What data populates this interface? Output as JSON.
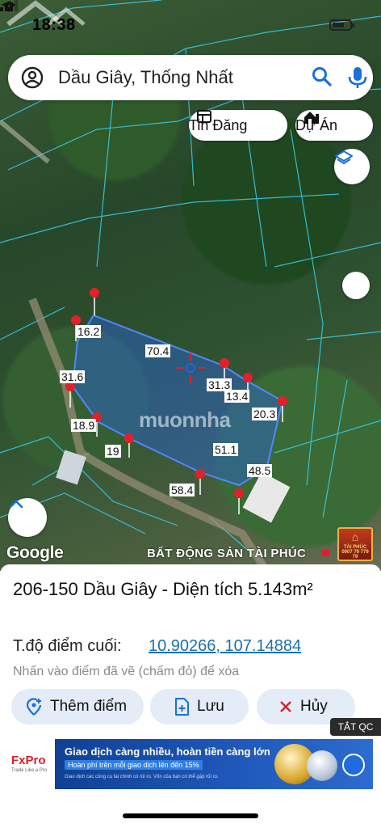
{
  "status_bar": {
    "time": "18:38"
  },
  "search": {
    "value": "Dầu Giây, Thống Nhất"
  },
  "chips": {
    "tin_dang": "Tin Đăng",
    "du_an": "Dự Án"
  },
  "map": {
    "segment_labels": [
      "16.2",
      "70.4",
      "31.6",
      "31.3",
      "13.4",
      "18.9",
      "20.3",
      "19",
      "51.1",
      "48.5",
      "58.4"
    ],
    "watermark": "muonnha",
    "google": "Google",
    "brand": "BẤT ĐỘNG SẢN TÀI PHÚC",
    "logo_text": "TÀI PHÚC",
    "logo_phone": "0907 79 779 79"
  },
  "sheet": {
    "title": "206-150 Dầu Giây - Diện tích 5.143m²",
    "coords_label": "T.độ điểm cuối:",
    "coords_value": "10.90266, 107.14884",
    "hint": "Nhấn vào điểm đã vẽ (chấm đỏ) để xóa",
    "buttons": {
      "add": "Thêm điểm",
      "save": "Lưu",
      "cancel": "Hủy"
    }
  },
  "ad": {
    "close": "TẮT QC",
    "brand": "FxPro",
    "brand_sub": "Trade Like a Pro",
    "headline": "Giao dịch càng nhiều, hoàn tiền càng lớn",
    "subline": "Hoàn phí trên mỗi giao dịch lên đến 15%",
    "disclaimer": "Giao dịch các công cụ tài chính có rủi ro. Vốn của bạn có thể gặp rủi ro."
  },
  "colors": {
    "accent": "#1a6fb5",
    "pin": "#e2202a",
    "polygon": "#2b63d9",
    "button_bg": "#e3ecf7"
  }
}
